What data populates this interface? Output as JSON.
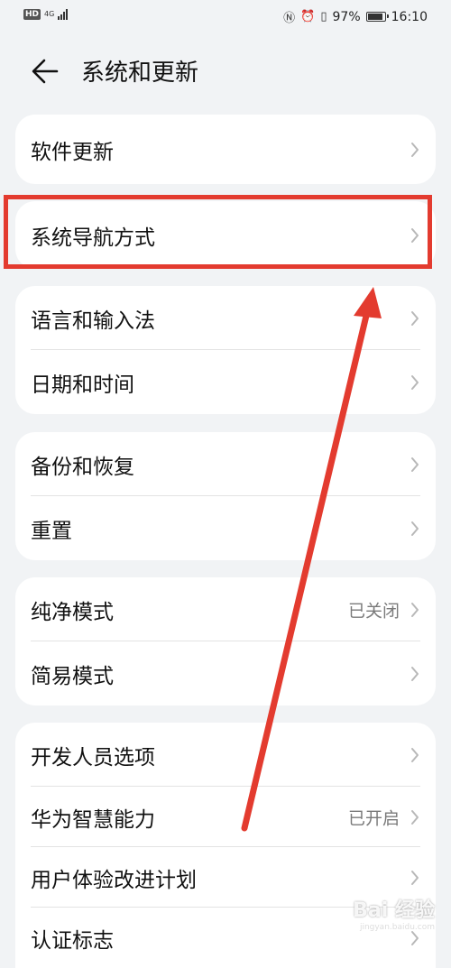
{
  "status_bar": {
    "hd": "HD",
    "network": "4G",
    "battery_text": "97%",
    "battery_level": 0.97,
    "time": "16:10"
  },
  "header": {
    "title": "系统和更新"
  },
  "groups": [
    {
      "items": [
        {
          "label": "软件更新"
        }
      ]
    },
    {
      "items": [
        {
          "label": "系统导航方式"
        }
      ]
    },
    {
      "items": [
        {
          "label": "语言和输入法"
        },
        {
          "label": "日期和时间"
        }
      ]
    },
    {
      "items": [
        {
          "label": "备份和恢复"
        },
        {
          "label": "重置"
        }
      ]
    },
    {
      "items": [
        {
          "label": "纯净模式",
          "status": "已关闭"
        },
        {
          "label": "简易模式"
        }
      ]
    },
    {
      "items": [
        {
          "label": "开发人员选项"
        },
        {
          "label": "华为智慧能力",
          "status": "已开启"
        },
        {
          "label": "用户体验改进计划"
        },
        {
          "label": "认证标志"
        }
      ]
    }
  ],
  "annotation": {
    "color": "#e33b2f"
  },
  "watermark": {
    "text": "Bai 经验",
    "sub": "jingyan.baidu.com"
  }
}
